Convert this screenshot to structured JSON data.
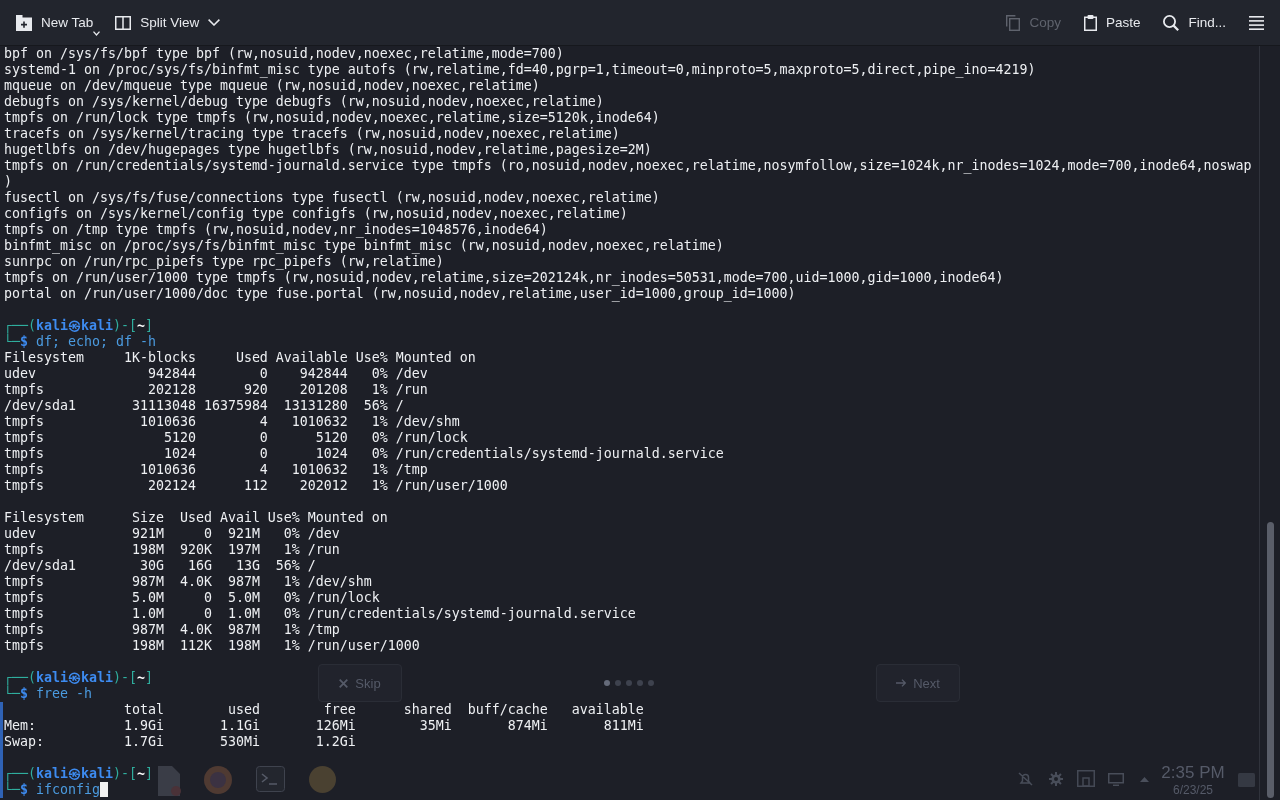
{
  "toolbar": {
    "buttons": [
      {
        "kind": "new_tab",
        "label": "New Tab",
        "disabled": false
      },
      {
        "kind": "split_view",
        "label": "Split View",
        "disabled": false
      },
      {
        "kind": "copy",
        "label": "Copy",
        "disabled": true
      },
      {
        "kind": "paste",
        "label": "Paste",
        "disabled": false
      },
      {
        "kind": "find",
        "label": "Find...",
        "disabled": false
      }
    ]
  },
  "terminal": {
    "blocks": [
      {
        "marked": false,
        "lines": [
          {
            "kind": "output",
            "text": "bpf on /sys/fs/bpf type bpf (rw,nosuid,nodev,noexec,relatime,mode=700)"
          },
          {
            "kind": "output",
            "text": "systemd-1 on /proc/sys/fs/binfmt_misc type autofs (rw,relatime,fd=40,pgrp=1,timeout=0,minproto=5,maxproto=5,direct,pipe_ino=4219)"
          },
          {
            "kind": "output",
            "text": "mqueue on /dev/mqueue type mqueue (rw,nosuid,nodev,noexec,relatime)"
          },
          {
            "kind": "output",
            "text": "debugfs on /sys/kernel/debug type debugfs (rw,nosuid,nodev,noexec,relatime)"
          },
          {
            "kind": "output",
            "text": "tmpfs on /run/lock type tmpfs (rw,nosuid,nodev,noexec,relatime,size=5120k,inode64)"
          },
          {
            "kind": "output",
            "text": "tracefs on /sys/kernel/tracing type tracefs (rw,nosuid,nodev,noexec,relatime)"
          },
          {
            "kind": "output",
            "text": "hugetlbfs on /dev/hugepages type hugetlbfs (rw,nosuid,nodev,relatime,pagesize=2M)"
          },
          {
            "kind": "output",
            "text": "tmpfs on /run/credentials/systemd-journald.service type tmpfs (ro,nosuid,nodev,noexec,relatime,nosymfollow,size=1024k,nr_inodes=1024,mode=700,inode64,noswap"
          },
          {
            "kind": "output",
            "text": ")"
          },
          {
            "kind": "output",
            "text": "fusectl on /sys/fs/fuse/connections type fusectl (rw,nosuid,nodev,noexec,relatime)"
          },
          {
            "kind": "output",
            "text": "configfs on /sys/kernel/config type configfs (rw,nosuid,nodev,noexec,relatime)"
          },
          {
            "kind": "output",
            "text": "tmpfs on /tmp type tmpfs (rw,nosuid,nodev,nr_inodes=1048576,inode64)"
          },
          {
            "kind": "output",
            "text": "binfmt_misc on /proc/sys/fs/binfmt_misc type binfmt_misc (rw,nosuid,nodev,noexec,relatime)"
          },
          {
            "kind": "output",
            "text": "sunrpc on /run/rpc_pipefs type rpc_pipefs (rw,relatime)"
          },
          {
            "kind": "output",
            "text": "tmpfs on /run/user/1000 type tmpfs (rw,nosuid,nodev,relatime,size=202124k,nr_inodes=50531,mode=700,uid=1000,gid=1000,inode64)"
          },
          {
            "kind": "output",
            "text": "portal on /run/user/1000/doc type fuse.portal (rw,nosuid,nodev,relatime,user_id=1000,group_id=1000)"
          },
          {
            "kind": "blank"
          },
          {
            "kind": "prompt",
            "parts": [
              {
                "kind": "frame",
                "text": "┌──("
              },
              {
                "kind": "user",
                "text": "kali㉿kali"
              },
              {
                "kind": "frame",
                "text": ")-["
              },
              {
                "kind": "path",
                "text": "~"
              },
              {
                "kind": "frame",
                "text": "]"
              }
            ]
          },
          {
            "kind": "command",
            "cursor": false,
            "parts": [
              {
                "kind": "frame",
                "text": "└─"
              },
              {
                "kind": "symbol",
                "text": "$"
              },
              {
                "kind": "command",
                "text": " df; echo; df -h"
              }
            ]
          },
          {
            "kind": "output",
            "text": "Filesystem     1K-blocks     Used Available Use% Mounted on"
          },
          {
            "kind": "output",
            "text": "udev              942844        0    942844   0% /dev"
          },
          {
            "kind": "output",
            "text": "tmpfs             202128      920    201208   1% /run"
          },
          {
            "kind": "output",
            "text": "/dev/sda1       31113048 16375984  13131280  56% /"
          },
          {
            "kind": "output",
            "text": "tmpfs            1010636        4   1010632   1% /dev/shm"
          },
          {
            "kind": "output",
            "text": "tmpfs               5120        0      5120   0% /run/lock"
          },
          {
            "kind": "output",
            "text": "tmpfs               1024        0      1024   0% /run/credentials/systemd-journald.service"
          },
          {
            "kind": "output",
            "text": "tmpfs            1010636        4   1010632   1% /tmp"
          },
          {
            "kind": "output",
            "text": "tmpfs             202124      112    202012   1% /run/user/1000"
          },
          {
            "kind": "blank"
          },
          {
            "kind": "output",
            "text": "Filesystem      Size  Used Avail Use% Mounted on"
          },
          {
            "kind": "output",
            "text": "udev            921M     0  921M   0% /dev"
          },
          {
            "kind": "output",
            "text": "tmpfs           198M  920K  197M   1% /run"
          },
          {
            "kind": "output",
            "text": "/dev/sda1        30G   16G   13G  56% /"
          },
          {
            "kind": "output",
            "text": "tmpfs           987M  4.0K  987M   1% /dev/shm"
          },
          {
            "kind": "output",
            "text": "tmpfs           5.0M     0  5.0M   0% /run/lock"
          },
          {
            "kind": "output",
            "text": "tmpfs           1.0M     0  1.0M   0% /run/credentials/systemd-journald.service"
          },
          {
            "kind": "output",
            "text": "tmpfs           987M  4.0K  987M   1% /tmp"
          },
          {
            "kind": "output",
            "text": "tmpfs           198M  112K  198M   1% /run/user/1000"
          },
          {
            "kind": "blank"
          },
          {
            "kind": "prompt",
            "parts": [
              {
                "kind": "frame",
                "text": "┌──("
              },
              {
                "kind": "user",
                "text": "kali㉿kali"
              },
              {
                "kind": "frame",
                "text": ")-["
              },
              {
                "kind": "path",
                "text": "~"
              },
              {
                "kind": "frame",
                "text": "]"
              }
            ]
          },
          {
            "kind": "command",
            "cursor": false,
            "parts": [
              {
                "kind": "frame",
                "text": "└─"
              },
              {
                "kind": "symbol",
                "text": "$"
              },
              {
                "kind": "command",
                "text": " free -h"
              }
            ]
          }
        ]
      },
      {
        "marked": true,
        "lines": [
          {
            "kind": "output",
            "text": "               total        used        free      shared  buff/cache   available"
          },
          {
            "kind": "output",
            "text": "Mem:           1.9Gi       1.1Gi       126Mi        35Mi       874Mi       811Mi"
          },
          {
            "kind": "output",
            "text": "Swap:          1.7Gi       530Mi       1.2Gi"
          },
          {
            "kind": "blank"
          },
          {
            "kind": "prompt",
            "parts": [
              {
                "kind": "frame",
                "text": "┌──("
              },
              {
                "kind": "user",
                "text": "kali㉿kali"
              },
              {
                "kind": "frame",
                "text": ")-["
              },
              {
                "kind": "path",
                "text": "~"
              },
              {
                "kind": "frame",
                "text": "]"
              }
            ]
          },
          {
            "kind": "command",
            "cursor": true,
            "parts": [
              {
                "kind": "frame",
                "text": "└─"
              },
              {
                "kind": "symbol",
                "text": "$"
              },
              {
                "kind": "command",
                "text": " ifconfig"
              }
            ]
          }
        ]
      }
    ]
  },
  "desktop": {
    "dialog": {
      "buttons": [
        {
          "kind": "skip",
          "label": "Skip"
        },
        {
          "kind": "next",
          "label": "Next"
        }
      ],
      "pages": [
        {
          "selected": true
        },
        {
          "selected": false
        },
        {
          "selected": false
        },
        {
          "selected": false
        },
        {
          "selected": false
        }
      ]
    },
    "clock": {
      "time": "2:35 PM",
      "date": "6/23/25"
    }
  }
}
